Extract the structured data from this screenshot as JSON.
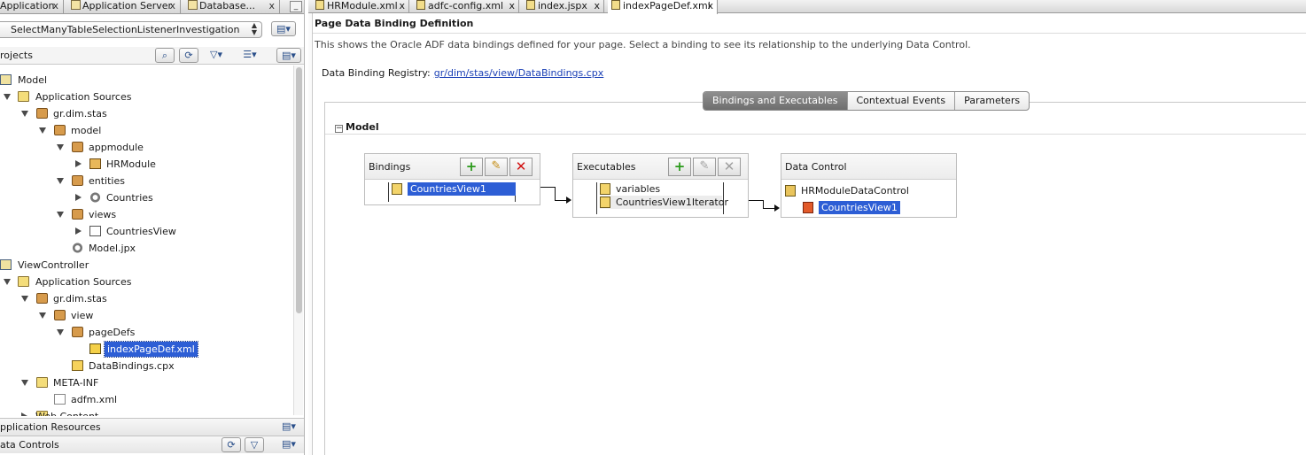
{
  "left": {
    "tabs": [
      {
        "label": "Application",
        "close": "x"
      },
      {
        "label": "Application Server",
        "close": "x"
      },
      {
        "label": "Database...",
        "close": "x"
      }
    ],
    "minimize": "_",
    "app_selector": "SelectManyTableSelectionListenerInvestigation",
    "projects_label": "rojects",
    "tree": [
      {
        "label": "Model"
      },
      {
        "label": "Application Sources"
      },
      {
        "label": "gr.dim.stas"
      },
      {
        "label": "model"
      },
      {
        "label": "appmodule"
      },
      {
        "label": "HRModule"
      },
      {
        "label": "entities"
      },
      {
        "label": "Countries"
      },
      {
        "label": "views"
      },
      {
        "label": "CountriesView"
      },
      {
        "label": "Model.jpx"
      },
      {
        "label": "ViewController"
      },
      {
        "label": "Application Sources"
      },
      {
        "label": "gr.dim.stas"
      },
      {
        "label": "view"
      },
      {
        "label": "pageDefs"
      },
      {
        "label": "indexPageDef.xml"
      },
      {
        "label": "DataBindings.cpx"
      },
      {
        "label": "META-INF"
      },
      {
        "label": "adfm.xml"
      },
      {
        "label": "Web Content"
      }
    ],
    "app_resources": "pplication Resources",
    "data_controls": "ata Controls"
  },
  "editor": {
    "tabs": [
      {
        "label": "HRModule.xml",
        "close": "x"
      },
      {
        "label": "adfc-config.xml",
        "close": "x"
      },
      {
        "label": "index.jspx",
        "close": "x"
      },
      {
        "label": "indexPageDef.xml",
        "close": "x"
      }
    ],
    "title": "Page Data Binding Definition",
    "description": "This shows the Oracle ADF data bindings defined for your page. Select a binding to see its relationship to the underlying Data Control.",
    "registry_label": "Data Binding Registry:",
    "registry_link": "gr/dim/stas/view/DataBindings.cpx",
    "segments": [
      "Bindings and Executables",
      "Contextual Events",
      "Parameters"
    ],
    "section_toggle": "−",
    "section": "Model",
    "bindings": {
      "title": "Bindings",
      "items": [
        "CountriesView1"
      ]
    },
    "executables": {
      "title": "Executables",
      "items": [
        "variables",
        "CountriesView1Iterator"
      ]
    },
    "data_control": {
      "title": "Data Control",
      "items": [
        "HRModuleDataControl",
        "CountriesView1"
      ]
    }
  }
}
